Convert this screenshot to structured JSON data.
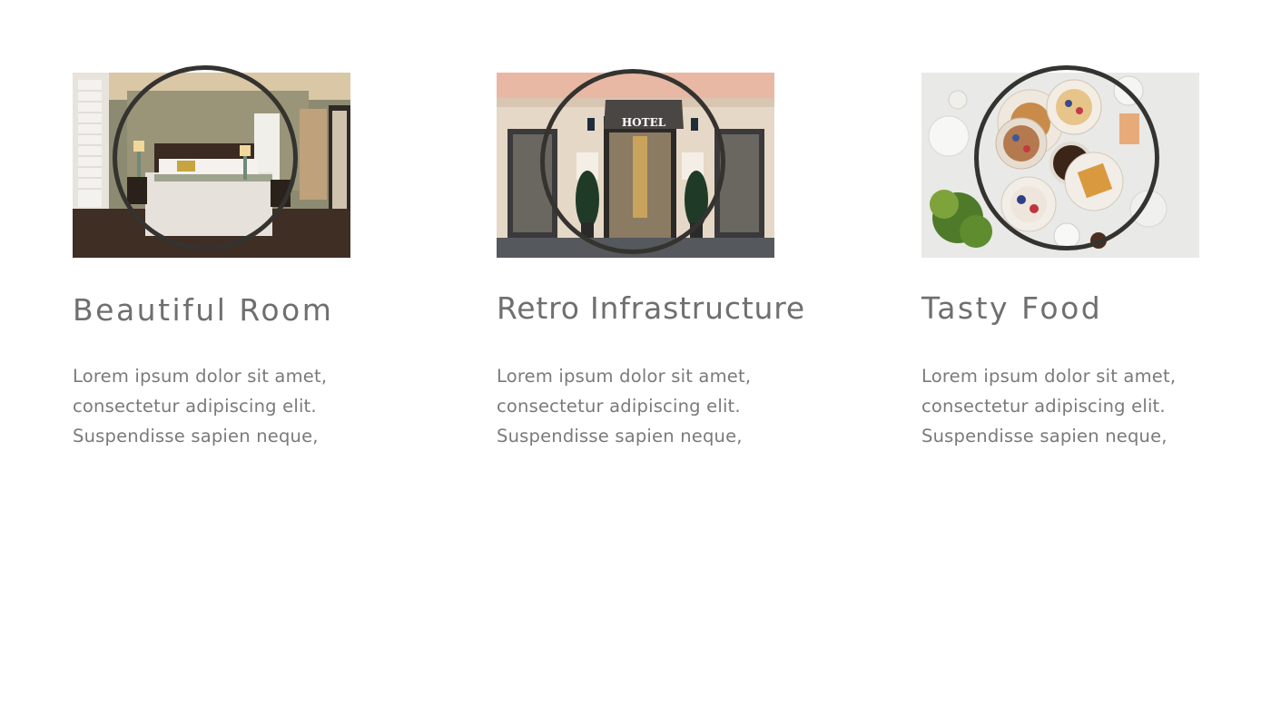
{
  "cards": [
    {
      "title": "Beautiful Room",
      "image": "bedroom-photo",
      "lines": [
        "Lorem ipsum dolor sit amet,",
        "consectetur adipiscing elit.",
        "Suspendisse sapien neque,"
      ]
    },
    {
      "title": "Retro Infrastructure",
      "image": "hotel-entrance-photo",
      "sign": "HOTEL",
      "lines": [
        "Lorem ipsum dolor sit amet,",
        "consectetur adipiscing elit.",
        "Suspendisse sapien neque,"
      ]
    },
    {
      "title": "Tasty Food",
      "image": "breakfast-table-photo",
      "lines": [
        "Lorem ipsum dolor sit amet,",
        "consectetur adipiscing elit.",
        "Suspendisse sapien neque,"
      ]
    }
  ],
  "colors": {
    "ring": "#34332f",
    "title": "#6f6f6f",
    "text": "#7a7a7a"
  }
}
